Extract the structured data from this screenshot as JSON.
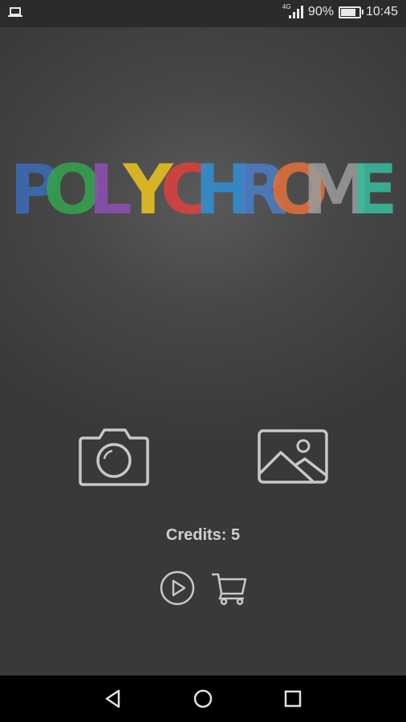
{
  "status_bar": {
    "network": "4G",
    "battery_text": "90%",
    "battery_level": 0.9,
    "time": "10:45",
    "icons": [
      "laptop-icon",
      "signal-icon",
      "battery-icon"
    ]
  },
  "logo": {
    "text": "POLYCHROME",
    "letter_colors": [
      "#3c6bb5",
      "#35a24f",
      "#8b4fb0",
      "#e8c21f",
      "#d9413f",
      "#2f8fd1",
      "#4a7cc4",
      "#e0703a",
      "#9a9a9a",
      "#39b99b"
    ]
  },
  "actions": {
    "camera_icon": "camera-icon",
    "gallery_icon": "image-icon"
  },
  "credits": {
    "label": "Credits: 5"
  },
  "extras": {
    "play_icon": "play-circle-icon",
    "cart_icon": "cart-icon"
  },
  "nav_bar": {
    "icons": [
      "back-icon",
      "home-icon",
      "recent-apps-icon"
    ]
  },
  "colors": {
    "icon_stroke": "#c8c8c8",
    "status_bar_bg": "#2b2b2b",
    "nav_bar_bg": "#000000"
  }
}
